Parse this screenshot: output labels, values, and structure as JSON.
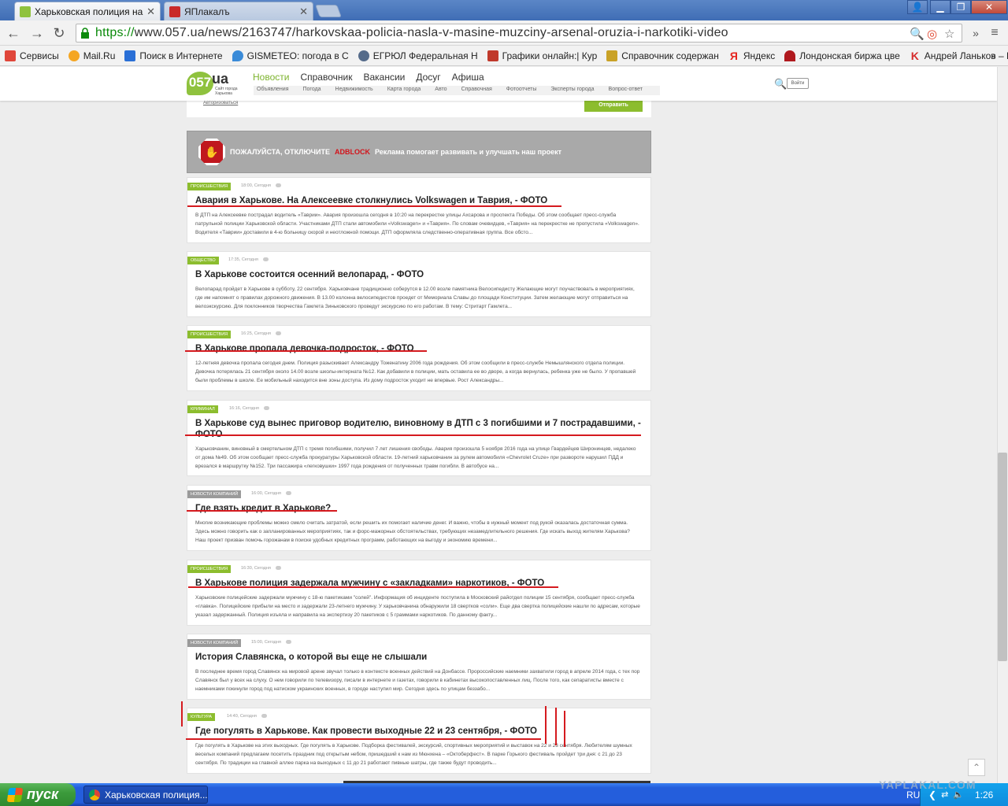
{
  "browser": {
    "tabs": [
      {
        "label": "Харьковская полиция нашл",
        "active": true
      },
      {
        "label": "ЯПлакалъ",
        "active": false
      }
    ],
    "url_scheme": "https://",
    "url_rest": "www.057.ua/news/2163747/harkovskaa-policia-nasla-v-masine-muzciny-arsenal-oruzia-i-narkotiki-video",
    "bookmarks": [
      {
        "label": "Сервисы",
        "icon": "apps-icon",
        "color": "#e0463a"
      },
      {
        "label": "Mail.Ru",
        "icon": "mailru-icon",
        "color": "#f5a623"
      },
      {
        "label": "Поиск в Интернете",
        "icon": "search-icon",
        "color": "#2a6fd6"
      },
      {
        "label": "GISMETEO: погода в С",
        "icon": "gismeteo-icon",
        "color": "#3a8bd8"
      },
      {
        "label": "ЕГРЮЛ Федеральная Н",
        "icon": "egrul-icon",
        "color": "#556b8a"
      },
      {
        "label": "Графики онлайн:| Кур",
        "icon": "chart-icon",
        "color": "#c0392b"
      },
      {
        "label": "Справочник содержан",
        "icon": "book-icon",
        "color": "#c9a227"
      },
      {
        "label": "Яндекс",
        "icon": "yandex-icon",
        "color": "#e52620"
      },
      {
        "label": "Лондонская биржа цве",
        "icon": "lme-icon",
        "color": "#b0191e"
      },
      {
        "label": "Андрей Ланьков – Кор",
        "icon": "k-icon",
        "color": "#d62b2b"
      }
    ]
  },
  "site": {
    "logo_main": "057",
    "logo_ua": "ua",
    "logo_sub": "Сайт города Харькова",
    "nav": [
      "Новости",
      "Справочник",
      "Вакансии",
      "Досуг",
      "Афиша"
    ],
    "subnav": [
      "Объявления",
      "Погода",
      "Недвижимость",
      "Карта города",
      "Авто",
      "Справочная",
      "Фотоотчеты",
      "Эксперты города",
      "Вопрос-ответ"
    ],
    "login": "Войти",
    "form_auth": "Авторизоваться",
    "form_send": "Отправить"
  },
  "adblock": {
    "t1": "ПОЖАЛУЙСТА, ОТКЛЮЧИТЕ",
    "t2": "ADBLOCK",
    "t3": "Реклама помогает развивать и улучшать наш проект"
  },
  "news": [
    {
      "tag": "Происшествия",
      "tag_color": "green",
      "meta": "18:00, Сегодня",
      "title": "Авария в Харькове. На Алексеевке столкнулись Volkswagen и Таврия, - ФОТО",
      "text": "В ДТП на Алексеевке пострадал водитель «Таврии». Авария произошла сегодня в 10:20 на перекрестке улицы Ахсарова и проспекта Победы. Об этом сообщает пресс-служба патрульной полиции Харьковской области. Участниками ДТП стали автомобили «Volkswagen» и «Таврия». По словам очевидцев, «Таврия» на перекрестке не пропустила «Volkswagen». Водителя «Таврии» доставили в 4-ю больницу скорой и неотложной помощи. ДТП оформляла следственно-оперативная группа. Все обсто..."
    },
    {
      "tag": "Общество",
      "tag_color": "green",
      "meta": "17:35, Сегодня",
      "title": "В Харькове состоится осенний велопарад, - ФОТО",
      "text": "Велопарад пройдет в Харькове в субботу, 22 сентября. Харьковчане традиционно соберутся в 12.00 возле памятника Велосипедисту Желающие могут поучаствовать в мероприятиях, где им напомнят о правилах дорожного движения. В 13.00 колонна велосипедистов проедет от Мемориала Славы до площади Конституции. Затем желающие могут отправиться на велоэкскурсию. Для поклонников творчества Гамлета Зиньковского проведут экскурсию по его работам. В тему: Стритарт Гамлета..."
    },
    {
      "tag": "Происшествия",
      "tag_color": "green",
      "meta": "16:25, Сегодня",
      "title": "В Харькове пропала девочка-подросток, - ФОТО",
      "text": "12-летняя девочка пропала сегодня днем. Полиция разыскивает Александру Тоженатину 2006 года рождения. Об этом сообщили в пресс-службе Немышлянского отдела полиции. Девочка потерялась 21 сентября около 14.00 возле школы-интерната №12. Как добавили в полиции, мать оставила ее во дворе, а когда вернулась, ребенка уже не было. У пропавшей были проблемы в школе. Ее мобильный находится вне зоны доступа. Из дому подросток уходит не впервые. Рост Александры..."
    },
    {
      "tag": "Криминал",
      "tag_color": "green",
      "meta": "16:16, Сегодня",
      "title": "В Харькове суд вынес приговор водителю, виновному в ДТП с 3 погибшими и 7 пострадавшими, - ФОТО",
      "text": "Харьковчанин, виновный в смертельном ДТП с тремя погибшими, получил 7 лет лишения свободы. Авария произошла 5 ноября 2016 года на улице Гвардейцев Широнинцев, недалеко от дома №49. Об этом сообщает пресс-служба прокуратуры Харьковской области. 19-летний харьковчанин за рулем автомобиля «Chevrolet Cruze» при развороте нарушил ПДД и врезался в маршрутку №152. Три пассажира «легковушки» 1997 года рождения от полученных травм погибли. В автобусе на..."
    },
    {
      "tag": "Новости компаний",
      "tag_color": "gray",
      "meta": "16:00, Сегодня",
      "title": "Где взять кредит в Харькове?",
      "text": "Многие возникающие проблемы можно смело считать затратой, если решить их помогает наличие денег. И важно, чтобы в нужный момент под рукой оказалась достаточная сумма. Здесь можно говорить как о запланированных мероприятиях, так и форс-мажорных обстоятельствах, требующих незамедлительного решения. Где искать выход жителям Харькова? Наш проект призван помочь горожанам в поиске удобных кредитных программ, работающих на выгоду и экономию времени..."
    },
    {
      "tag": "Происшествия",
      "tag_color": "green",
      "meta": "16:30, Сегодня",
      "title": "В Харькове полиция задержала мужчину с «закладками» наркотиков, - ФОТО",
      "text": "Харьковские полицейские задержали мужчину с 18-ю пакетиками \"солей\". Информация об инциденте поступила в Московский райотдел полиции 15 сентября, сообщает пресс-служба «главка». Полицейские прибыли на место и задержали 23-летнего мужчину. У харьковчанина обнаружили 18 свертков «соли». Еще два свертка полицейские нашли по адресам, которые указал задержанный. Полиция изъяла и направила на экспертизу 20 пакетиков с 5 граммами наркотиков. По данному факту..."
    },
    {
      "tag": "Новости компаний",
      "tag_color": "gray",
      "meta": "15:00, Сегодня",
      "title": "История Славянска, о которой вы еще не слышали",
      "text": "В последнее время город Славянск на мировой арене звучал только в контексте военных действий на Донбассе. Пророссийские наемники захватили город в апреле 2014 года, с тех пор Славянск был у всех на слуху. О нем говорили по телевизору, писали в интернете и газетах, говорили в кабинетах высокопоставленных лиц. После того, как сепаратисты вместе с наемниками покинули город под натиском украинских военных, в городе наступил мир. Сегодня здесь по улицам беззабо..."
    },
    {
      "tag": "Культура",
      "tag_color": "green",
      "meta": "14:40, Сегодня",
      "title": "Где погулять в Харькове. Как провести выходные 22 и 23 сентября, - ФОТО",
      "text": "Где погулять в Харькове на этих выходных. Где погулять в Харькове. Подборка фестивалей, экскурсий, спортивных мероприятий и выставок на 22 и 23 сентября. Любителям шумных веселых компаний предлагаем посетить праздник под открытым небом, пришедший к нам из Мюнхена – «Октоберфест». В парке Горького фестиваль пройдет три дня: с 21 до 23 сентября. По традиции на главной аллее парка на выходных с 11 до 21 работают пивные шатры, где также будут проводить..."
    }
  ],
  "taskbar": {
    "start": "пуск",
    "item": "Харьковская полиция...",
    "lang": "RU",
    "clock": "1:26"
  },
  "watermark": "YAPLAKAL.COM"
}
